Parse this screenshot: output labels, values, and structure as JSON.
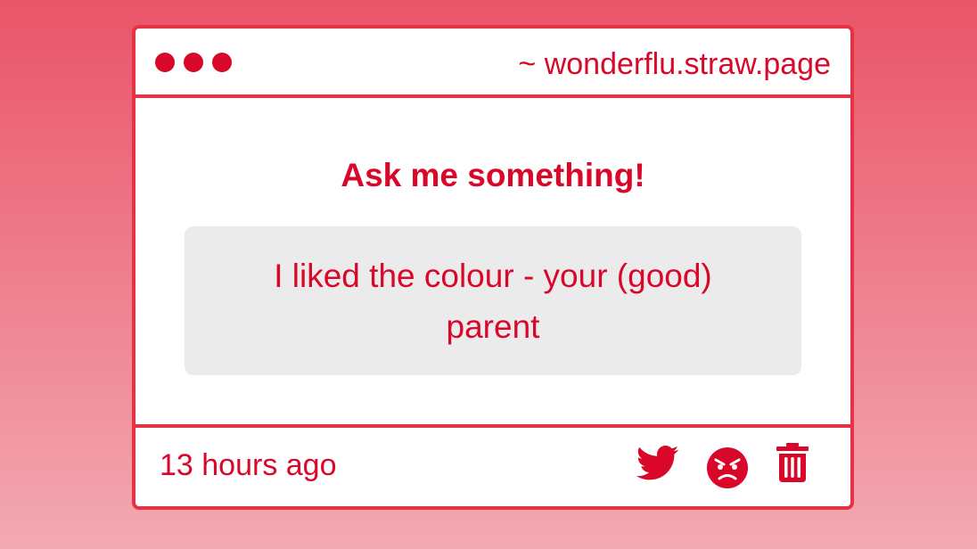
{
  "window": {
    "url": "~ wonderflu.straw.page"
  },
  "content": {
    "prompt": "Ask me something!",
    "message": "I liked the colour - your (good) parent"
  },
  "footer": {
    "timestamp": "13 hours ago",
    "icons": [
      "twitter-icon",
      "angry-face-icon",
      "trash-icon"
    ]
  },
  "colors": {
    "accent": "#d9072a",
    "border": "#e53244",
    "message_bg": "#ecebec",
    "background_top": "#ea5468",
    "background_bottom": "#f3a9b3"
  }
}
